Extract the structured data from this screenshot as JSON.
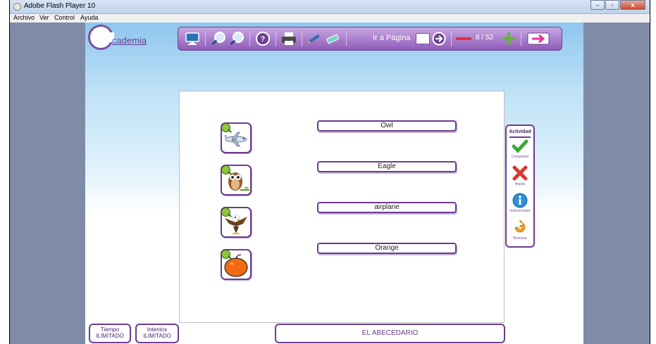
{
  "window": {
    "title": "Adobe Flash Player 10",
    "buttons": [
      "–",
      "▫",
      "x"
    ]
  },
  "menu": [
    "Archivo",
    "Ver",
    "Control",
    "Ayuda"
  ],
  "logo": {
    "text": "cademia"
  },
  "toolbar": {
    "goto_label": "Ir a Página",
    "goto_value": "",
    "page_indicator": "8 / 52",
    "icons": [
      "monitor-icon",
      "zoom-in-icon",
      "zoom-out-icon",
      "help-icon",
      "print-icon",
      "pen-icon",
      "eraser-icon",
      "go-arrow-icon",
      "minus-icon",
      "plus-icon",
      "exit-icon"
    ]
  },
  "activity": {
    "pictures": [
      {
        "name": "airplane"
      },
      {
        "name": "owl"
      },
      {
        "name": "eagle"
      },
      {
        "name": "orange"
      }
    ],
    "words": [
      "Owl",
      "Eagle",
      "airplane",
      "Orange"
    ]
  },
  "side_panel": {
    "title": "Actividad",
    "items": [
      {
        "label": "Comprobar",
        "icon": "check-icon",
        "color": "#39a935"
      },
      {
        "label": "limpiar",
        "icon": "cross-icon",
        "color": "#d63a2c"
      },
      {
        "label": "Instrucciones",
        "icon": "info-icon",
        "color": "#2e8fd8"
      },
      {
        "label": "Reiniciar",
        "icon": "restart-icon",
        "color": "#f0a21c"
      }
    ]
  },
  "status": {
    "time_label": "Tiempo",
    "time_value": "ILIMITADO",
    "attempts_label": "Intentos",
    "attempts_value": "ILIMITADO",
    "lesson_title": "EL ABECEDARIO"
  },
  "colors": {
    "accent": "#6c3b8f",
    "toolbar": "#a97ccf",
    "sky": "#8fc6ee",
    "background": "#7f8ca8"
  }
}
